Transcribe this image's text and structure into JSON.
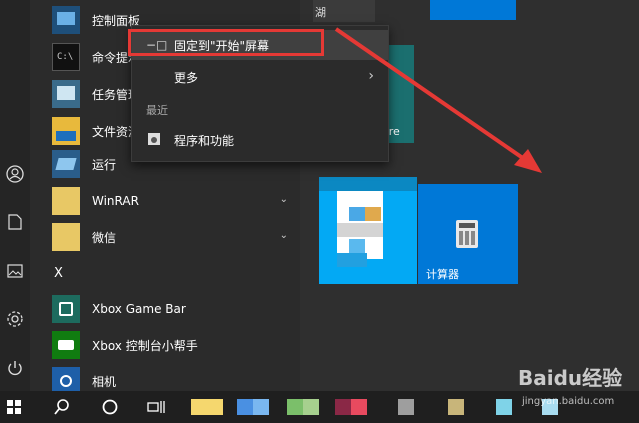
{
  "apps": [
    {
      "label": "控制面板"
    },
    {
      "label": "命令提示符"
    },
    {
      "label": "任务管理器"
    },
    {
      "label": "文件资源管理器"
    },
    {
      "label": "运行"
    },
    {
      "label": "WinRAR"
    },
    {
      "label": "微信"
    },
    {
      "label": "Xbox Game Bar"
    },
    {
      "label": "Xbox 控制台小帮手"
    },
    {
      "label": "相机"
    }
  ],
  "section_letter": "X",
  "context_menu": {
    "pin_label": "固定到\"开始\"屏幕",
    "more_label": "更多",
    "recent_header": "最近",
    "recent_item": "程序和功能"
  },
  "tiles": {
    "calculator_label": "计算器",
    "partial_store_label": "ore",
    "partial_top_label": "湖"
  },
  "watermark": {
    "brand": "Baidu经验",
    "url": "jingyan.baidu.com"
  },
  "colors": {
    "highlight": "#e53935",
    "tile_blue": "#0078d7",
    "tile_light_blue": "#03a9f4",
    "teal": "#1b6f6f"
  }
}
